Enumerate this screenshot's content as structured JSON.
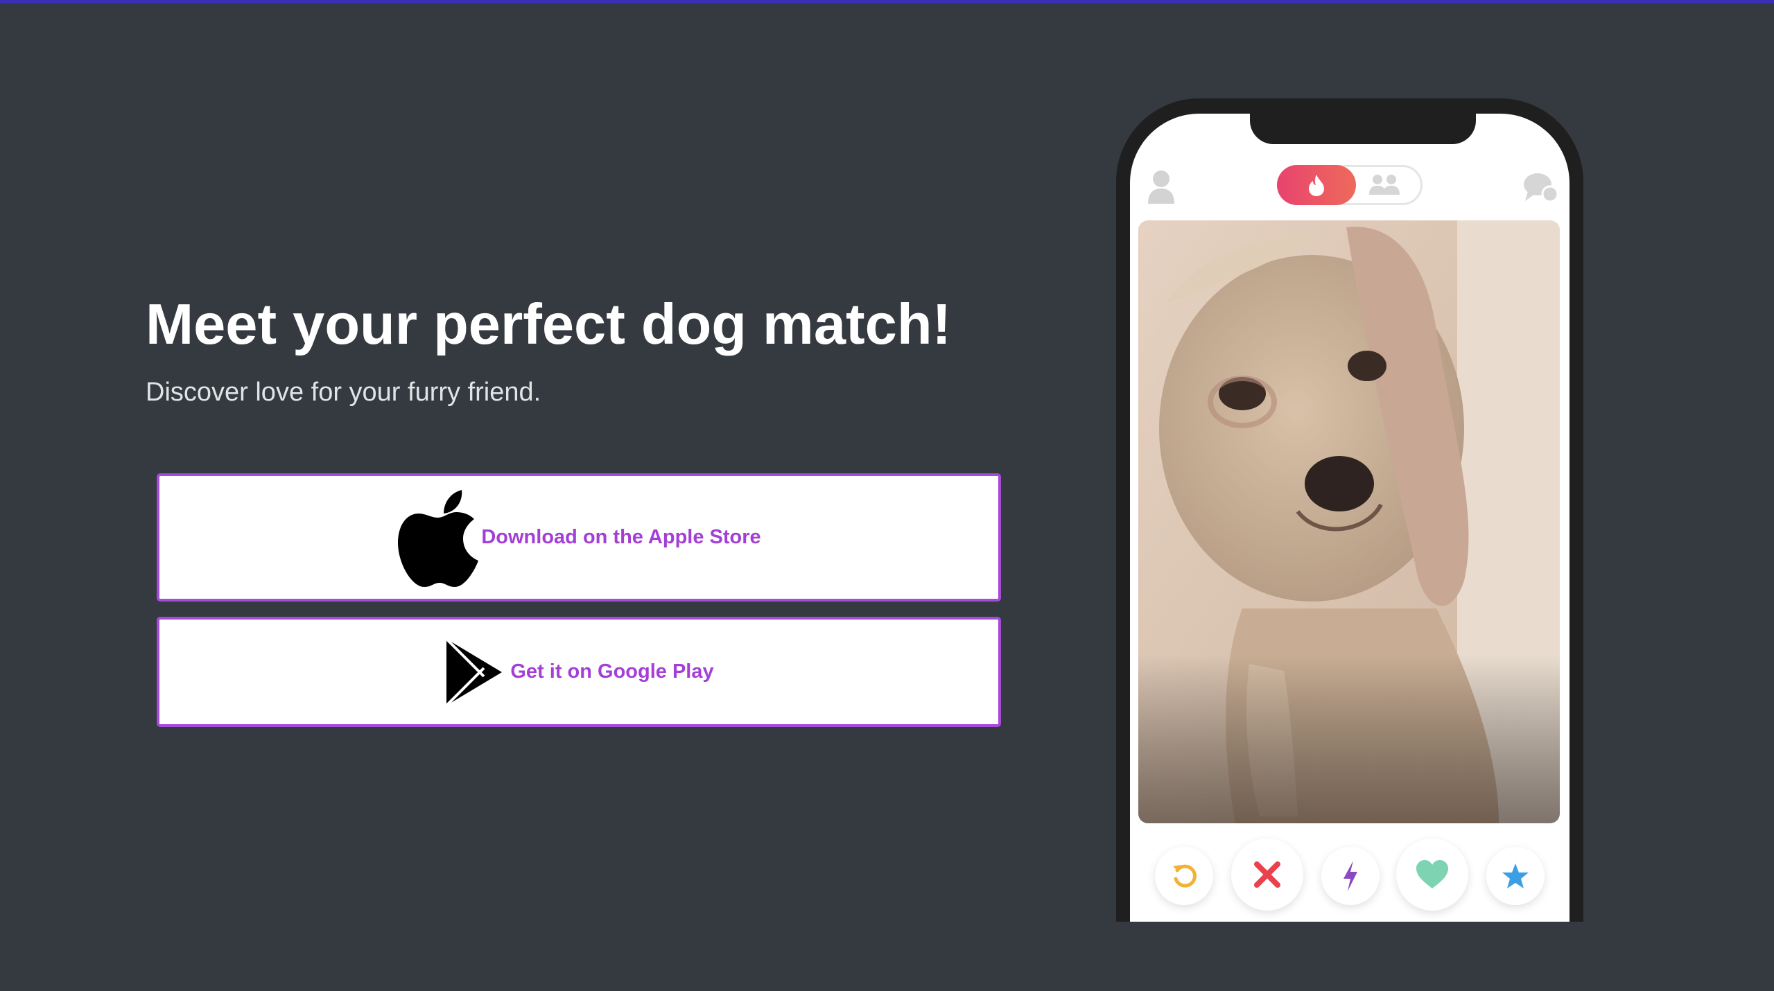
{
  "hero": {
    "title": "Meet your perfect dog match!",
    "subtitle": "Discover love for your furry friend."
  },
  "buttons": {
    "apple_label": "Download on the Apple Store",
    "google_label": "Get it on Google Play"
  },
  "phone": {
    "top_icons": [
      "profile-icon",
      "flame-icon",
      "group-icon",
      "chat-icon"
    ],
    "action_icons": [
      "undo-icon",
      "close-icon",
      "bolt-icon",
      "heart-icon",
      "star-icon"
    ]
  },
  "colors": {
    "page_background": "#343a40",
    "accent_purple": "#a43fd6",
    "tinder_gradient_start": "#e8436e",
    "tinder_gradient_end": "#ee6a5b"
  }
}
